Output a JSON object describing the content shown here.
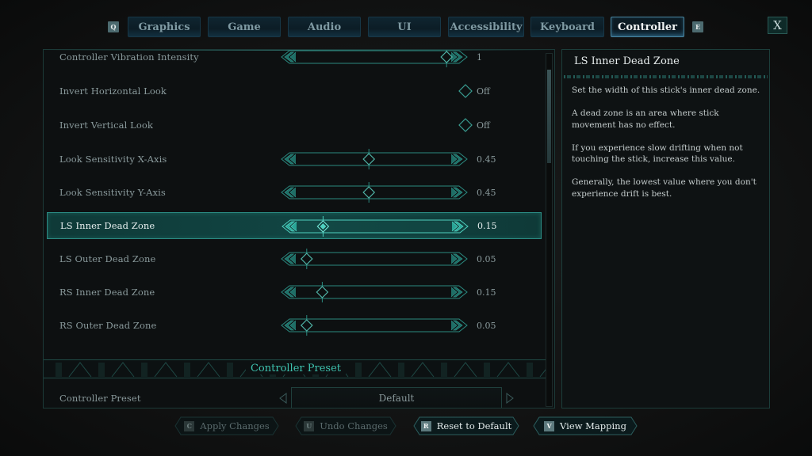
{
  "tabs": {
    "prev_key": "Q",
    "next_key": "E",
    "items": [
      {
        "label": "Graphics"
      },
      {
        "label": "Game"
      },
      {
        "label": "Audio"
      },
      {
        "label": "UI"
      },
      {
        "label": "Accessibility"
      },
      {
        "label": "Keyboard"
      },
      {
        "label": "Controller",
        "active": true
      }
    ],
    "close_label": "X"
  },
  "settings": {
    "rows": [
      {
        "label": "Controller Vibration Intensity",
        "type": "slider",
        "value": "1",
        "fraction": 0.95
      },
      {
        "label": "Invert Horizontal Look",
        "type": "toggle",
        "value": "Off"
      },
      {
        "label": "Invert Vertical Look",
        "type": "toggle",
        "value": "Off"
      },
      {
        "label": "Look Sensitivity X-Axis",
        "type": "slider",
        "value": "0.45",
        "fraction": 0.45
      },
      {
        "label": "Look Sensitivity Y-Axis",
        "type": "slider",
        "value": "0.45",
        "fraction": 0.45
      },
      {
        "label": "LS Inner Dead Zone",
        "type": "slider",
        "value": "0.15",
        "fraction": 0.15,
        "selected": true
      },
      {
        "label": "LS Outer Dead Zone",
        "type": "slider",
        "value": "0.05",
        "fraction": 0.05
      },
      {
        "label": "RS Inner Dead Zone",
        "type": "slider",
        "value": "0.15",
        "fraction": 0.15
      },
      {
        "label": "RS Outer Dead Zone",
        "type": "slider",
        "value": "0.05",
        "fraction": 0.05
      }
    ],
    "section_title": "Controller Preset",
    "preset": {
      "label": "Controller Preset",
      "value": "Default"
    }
  },
  "description": {
    "title": "LS Inner Dead Zone",
    "paragraphs": [
      "Set the width of this stick's inner dead zone.",
      "A dead zone is an area where stick movement has no effect.",
      "If you experience slow drifting when not touching the stick, increase this value.",
      "Generally, the lowest value where you don't experience drift is best."
    ]
  },
  "bottom_buttons": [
    {
      "key": "C",
      "label": "Apply Changes",
      "enabled": false
    },
    {
      "key": "U",
      "label": "Undo Changes",
      "enabled": false
    },
    {
      "key": "R",
      "label": "Reset to Default",
      "enabled": true
    },
    {
      "key": "V",
      "label": "View Mapping",
      "enabled": true
    }
  ],
  "colors": {
    "accent": "#3ec1ae",
    "slider_line": "#2b8a80",
    "selected_row_bg": "#114442"
  }
}
